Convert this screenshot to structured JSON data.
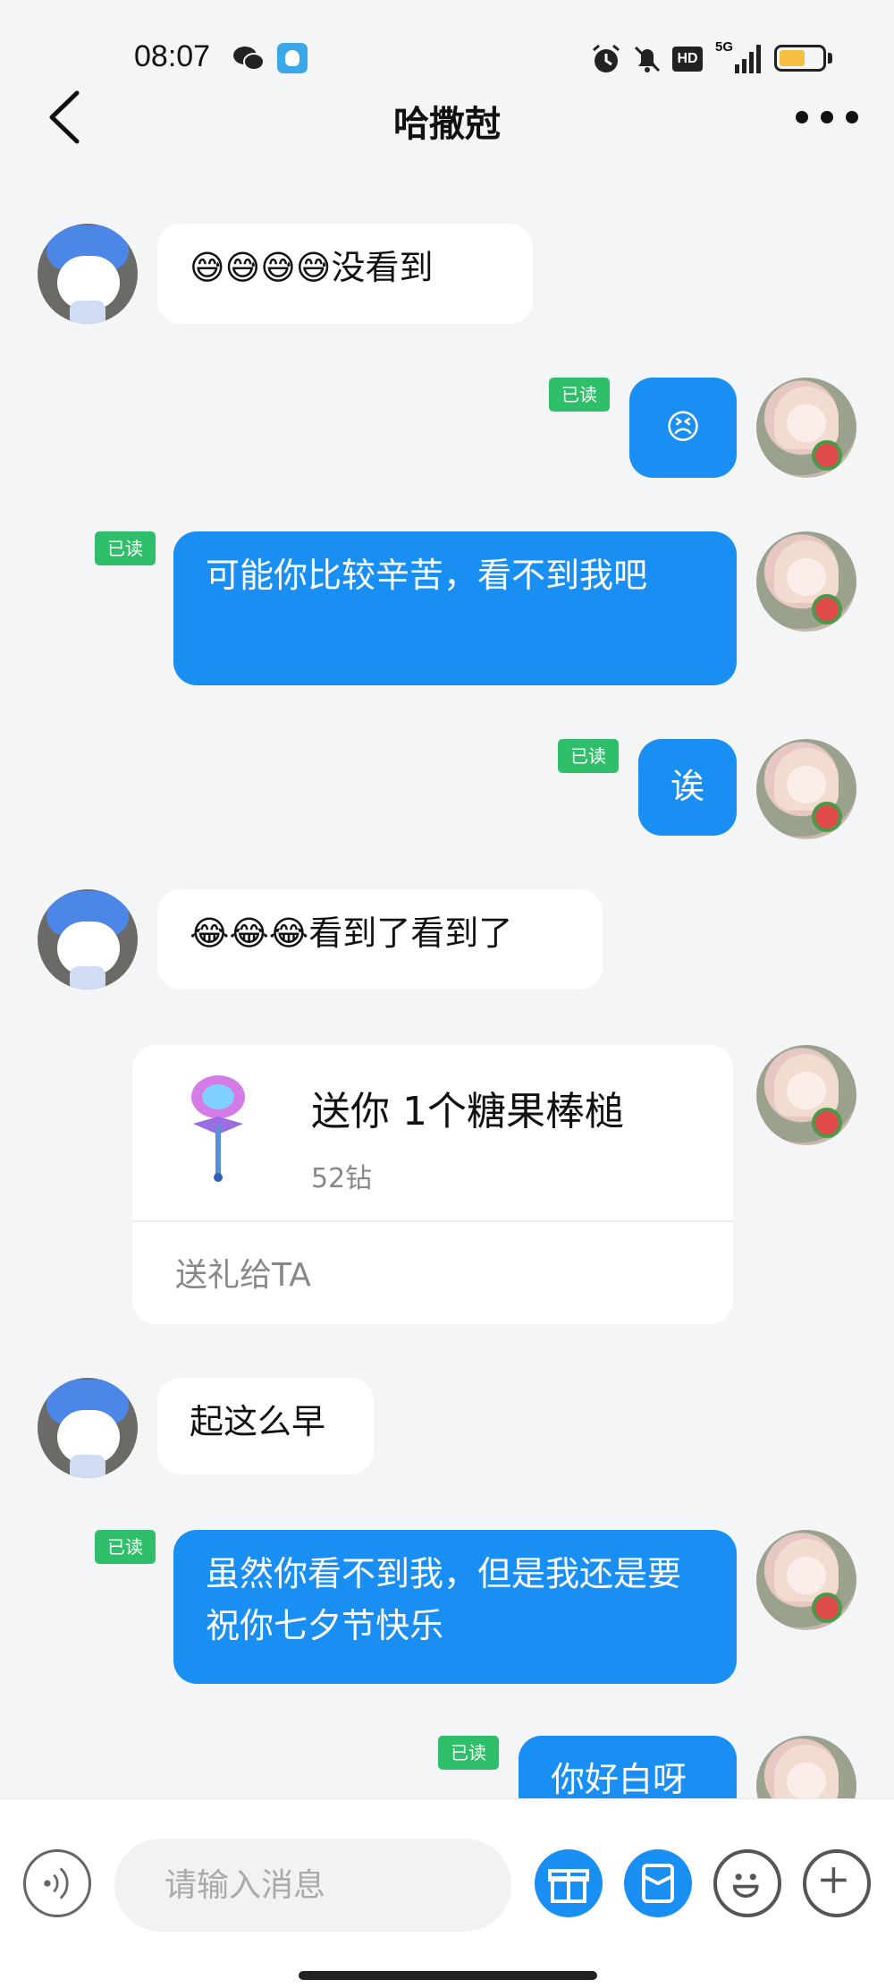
{
  "status_bar": {
    "time": "08:07",
    "network": "5G",
    "hd": "HD",
    "battery_level": 0.6,
    "icons": [
      "wechat-icon",
      "app-icon",
      "alarm-icon",
      "mute-icon",
      "hd-icon",
      "signal-icon",
      "battery-icon"
    ]
  },
  "header": {
    "title": "哈撒尅",
    "icons": [
      "back-arrow-icon",
      "more-dots-icon"
    ]
  },
  "messages": [
    {
      "from": "other",
      "text": "😅😅😅😅没看到"
    },
    {
      "from": "self",
      "text": "😣",
      "read": "已读"
    },
    {
      "from": "self",
      "text": "可能你比较辛苦，看不到我吧",
      "read": "已读"
    },
    {
      "from": "self",
      "text": "诶",
      "read": "已读"
    },
    {
      "from": "other",
      "text": "😂😂😂看到了看到了"
    },
    {
      "from": "self",
      "type": "gift",
      "gift": {
        "title": "送你 1个糖果棒槌",
        "price": "52钻",
        "action": "送礼给TA"
      }
    },
    {
      "from": "other",
      "text": "起这么早"
    },
    {
      "from": "self",
      "text": "虽然你看不到我，但是我还是要祝你七夕节快乐",
      "read": "已读"
    },
    {
      "from": "self",
      "text": "你好白呀",
      "read": "已读"
    }
  ],
  "input_bar": {
    "placeholder": "请输入消息",
    "value": "",
    "icons": [
      "voice-icon",
      "gift-icon",
      "red-packet-icon",
      "emoji-icon",
      "plus-icon"
    ]
  },
  "colors": {
    "accent": "#1a8ff3",
    "read_badge": "#2fbf6a",
    "background": "#f4f5f7"
  }
}
